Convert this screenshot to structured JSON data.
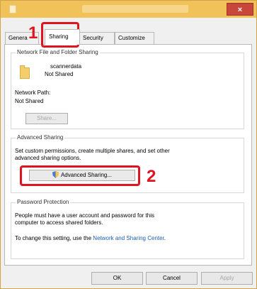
{
  "title": {
    "close_symbol": "×"
  },
  "tabs": [
    {
      "label": "Genera"
    },
    {
      "label": "Sharing"
    },
    {
      "label": "Security"
    },
    {
      "label": "Customize"
    }
  ],
  "network": {
    "group_title": "Network File and Folder Sharing",
    "folder_name": "scannerdata",
    "folder_status": "Not Shared",
    "path_label": "Network Path:",
    "path_value": "Not Shared",
    "share_button": "Share..."
  },
  "advanced": {
    "group_title": "Advanced Sharing",
    "description_line1": "Set custom permissions, create multiple shares, and set other",
    "description_line2": "advanced sharing options.",
    "button": "Advanced Sharing..."
  },
  "password": {
    "group_title": "Password Protection",
    "line1": "People must have a user account and password for this",
    "line2": "computer to access shared folders.",
    "change_prefix": "To change this setting, use the ",
    "link": "Network and Sharing Center",
    "change_suffix": "."
  },
  "footer": {
    "ok": "OK",
    "cancel": "Cancel",
    "apply": "Apply"
  },
  "callouts": {
    "step1": "1",
    "step2": "2"
  },
  "colors": {
    "titlebar": "#f2c25a",
    "highlight": "#e0141e",
    "link": "#1a5fb4"
  }
}
